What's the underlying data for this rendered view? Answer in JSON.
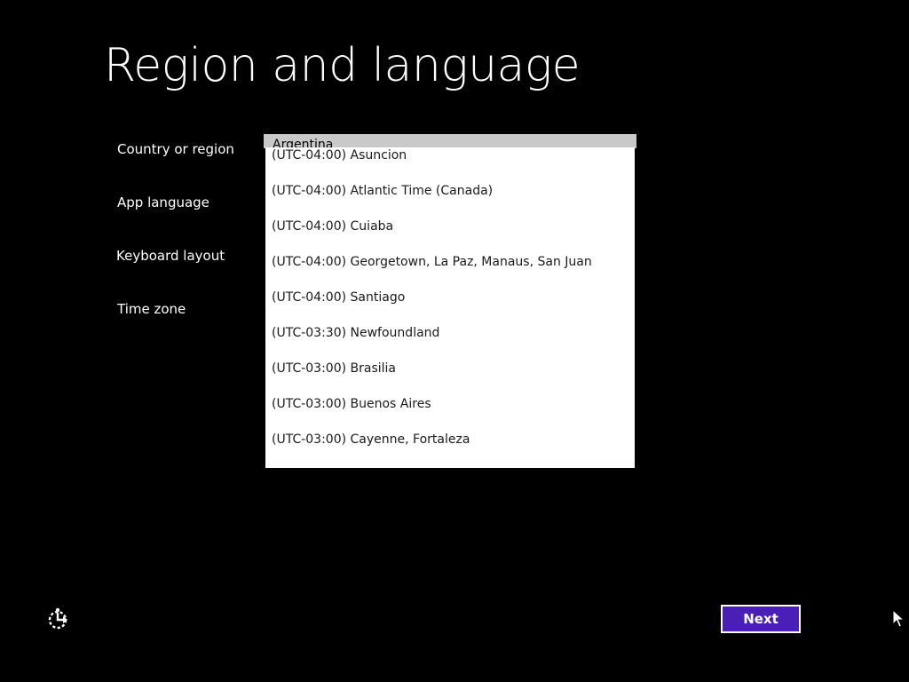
{
  "page": {
    "title": "Region and language"
  },
  "form": {
    "country_label": "Country or region",
    "app_language_label": "App language",
    "keyboard_layout_label": "Keyboard layout",
    "time_zone_label": "Time zone",
    "country_value": "Argentina"
  },
  "time_zone_dropdown": {
    "items": [
      "(UTC-04:00) Asuncion",
      "(UTC-04:00) Atlantic Time (Canada)",
      "(UTC-04:00) Cuiaba",
      "(UTC-04:00) Georgetown, La Paz, Manaus, San Juan",
      "(UTC-04:00) Santiago",
      "(UTC-03:30) Newfoundland",
      "(UTC-03:00) Brasilia",
      "(UTC-03:00) Buenos Aires",
      "(UTC-03:00) Cayenne, Fortaleza"
    ]
  },
  "footer": {
    "next_label": "Next",
    "accessibility_icon": "ease-of-access-icon"
  },
  "colors": {
    "background": "#000000",
    "accent": "#4a1fb8",
    "dropdown_background": "#ffffff",
    "select_background": "#c9c9c9"
  }
}
